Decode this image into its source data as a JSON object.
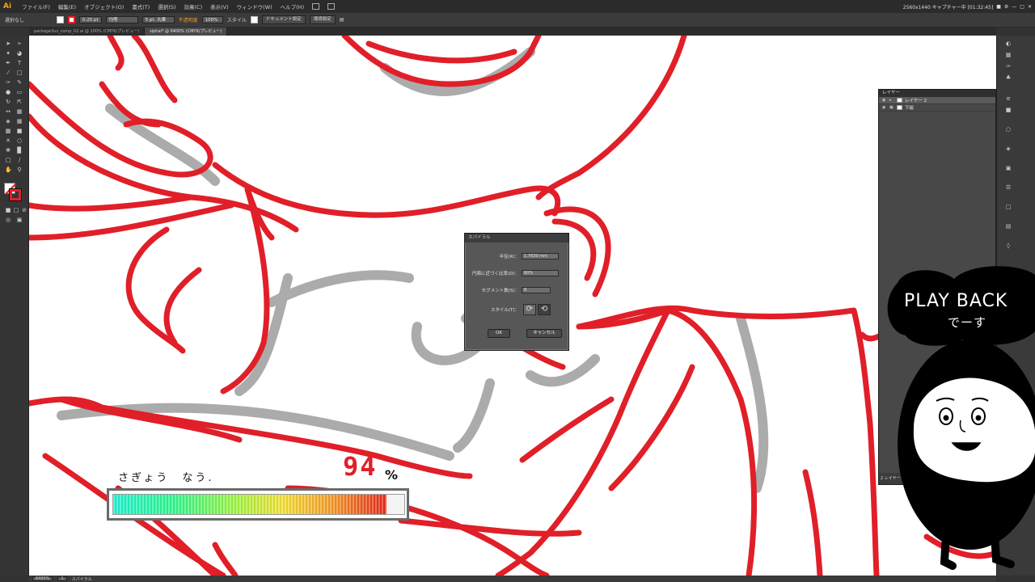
{
  "app": {
    "logo": "Ai",
    "menu": [
      "ファイル(F)",
      "編集(E)",
      "オブジェクト(O)",
      "書式(T)",
      "選択(S)",
      "効果(C)",
      "表示(V)",
      "ウィンドウ(W)",
      "ヘルプ(H)"
    ],
    "status_text": "2560x1440 キャプチャー中 [01:32:45]"
  },
  "controlbar": {
    "selection_label": "選択なし",
    "stroke_width": "0.25 pt",
    "stroke_style": "均等",
    "brush": "5 pt. 丸筆",
    "opacity_label": "不透明度",
    "opacity_value": "100%",
    "style_label": "スタイル",
    "doc_settings": "ドキュメント設定",
    "env_settings": "環境設定"
  },
  "tabs": [
    {
      "label": "package3us_comp_02.ai @ 100% (CMYK/プレビュー)",
      "active": false
    },
    {
      "label": "siphai* @ 6400% (CMYK/プレビュー)",
      "active": true
    }
  ],
  "layers_panel": {
    "title": "レイヤー",
    "layers": [
      {
        "name": "レイヤー 2",
        "selected": true
      },
      {
        "name": "下絵",
        "selected": false
      }
    ],
    "footer": "2 レイヤー"
  },
  "spiral_dialog": {
    "title": "スパイラル",
    "radius_label": "半径(R)：",
    "radius_value": "1.7639 mm",
    "decay_label": "円周に近づく比率(D)：",
    "decay_value": "80%",
    "segments_label": "セグメント数(S)：",
    "segments_value": "8",
    "style_label": "スタイル(T)：",
    "ok": "OK",
    "cancel": "キャンセル"
  },
  "overlay": {
    "caption": "さぎょう　なう.",
    "percent_value": "94",
    "percent_sign": "%",
    "progress_fraction": 0.94,
    "playback_title": "PLAY BACK",
    "playback_sub": "でーす"
  },
  "statusbar": {
    "zoom": "6400%",
    "page": "1",
    "tool_name": "スパイラル"
  },
  "colors": {
    "stroke_red": "#e01f28",
    "accent_orange": "#f7a11a"
  }
}
